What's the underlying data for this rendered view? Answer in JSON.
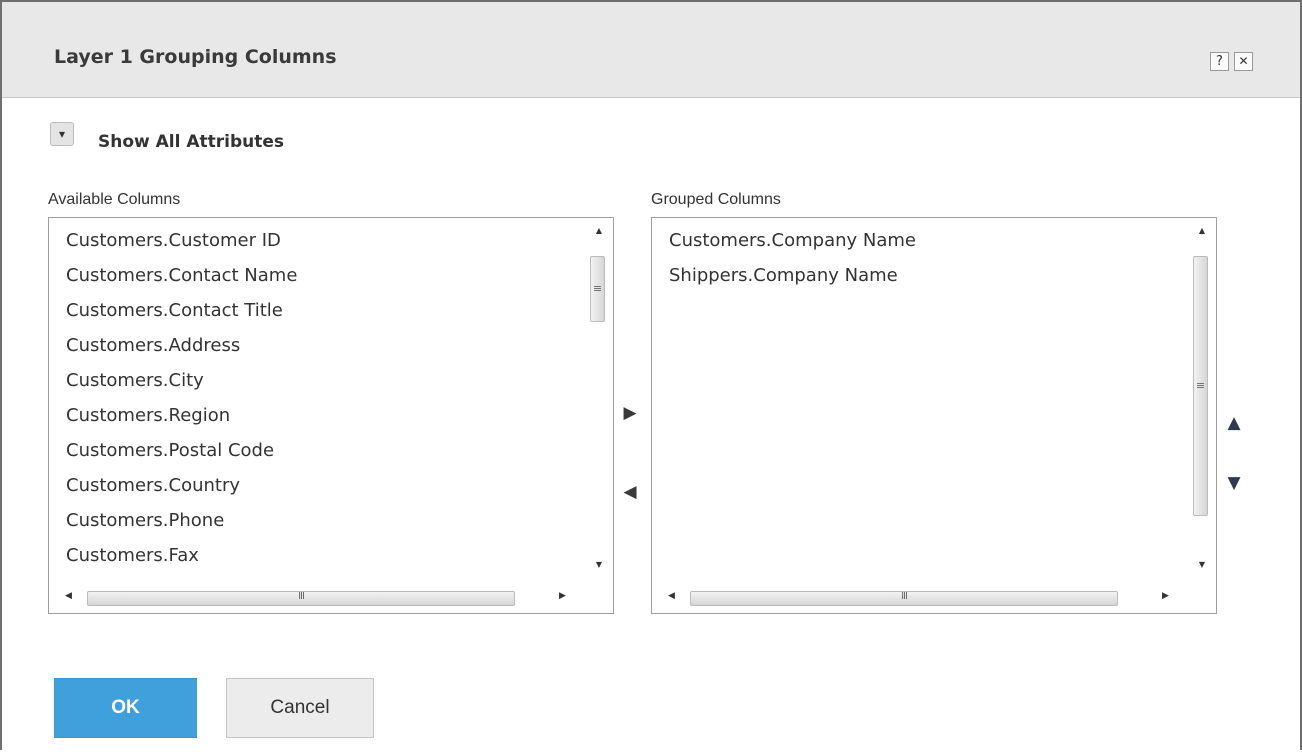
{
  "dialog": {
    "title": "Layer 1 Grouping Columns",
    "help_glyph": "?",
    "close_glyph": "✕"
  },
  "show_all": {
    "toggle_glyph": "▾",
    "label": "Show All Attributes"
  },
  "available": {
    "label": "Available Columns",
    "items": [
      "Customers.Customer ID",
      "Customers.Contact Name",
      "Customers.Contact Title",
      "Customers.Address",
      "Customers.City",
      "Customers.Region",
      "Customers.Postal Code",
      "Customers.Country",
      "Customers.Phone",
      "Customers.Fax"
    ]
  },
  "grouped": {
    "label": "Grouped Columns",
    "items": [
      "Customers.Company Name",
      "Shippers.Company Name"
    ]
  },
  "move": {
    "add_glyph": "▶",
    "remove_glyph": "◀",
    "up_glyph": "▲",
    "down_glyph": "▼"
  },
  "scroll": {
    "up_glyph": "▲",
    "down_glyph": "▼",
    "left_glyph": "◀",
    "right_glyph": "▶",
    "v_grip": "≡",
    "h_grip": "III"
  },
  "footer": {
    "ok_label": "OK",
    "cancel_label": "Cancel"
  },
  "colors": {
    "accent": "#3fa0dc",
    "titlebar": "#e8e8e8",
    "arrow_gray": "#3a3a3a",
    "arrow_navy": "#2e3a4f"
  }
}
